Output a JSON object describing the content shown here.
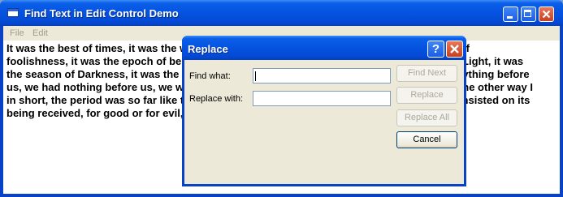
{
  "window": {
    "title": "Find Text in Edit Control Demo",
    "menu": [
      "File",
      "Edit"
    ]
  },
  "document": {
    "lines": [
      "It was the best of times, it was the worst of times, it was the age of wisdom, it was the age of",
      "foolishness, it was the epoch of belief, it was the epoch of incredulity, it was the season of Light, it was",
      "the season of Darkness, it was the spring of hope, it was the winter of despair, we had everything before",
      "us, we had nothing before us, we were all going direct to Heaven, we were all going direct the other way I",
      "in short, the period was so far like the present period, that some of its noisiest authorities insisted on its",
      "being received, for good or for evil, in the superlative degree of comparison only."
    ]
  },
  "dialog": {
    "title": "Replace",
    "help_label": "?",
    "find_label": "Find what:",
    "find_value": "",
    "replace_label": "Replace with:",
    "replace_value": "",
    "buttons": {
      "find_next": "Find Next",
      "replace": "Replace",
      "replace_all": "Replace All",
      "cancel": "Cancel"
    }
  }
}
